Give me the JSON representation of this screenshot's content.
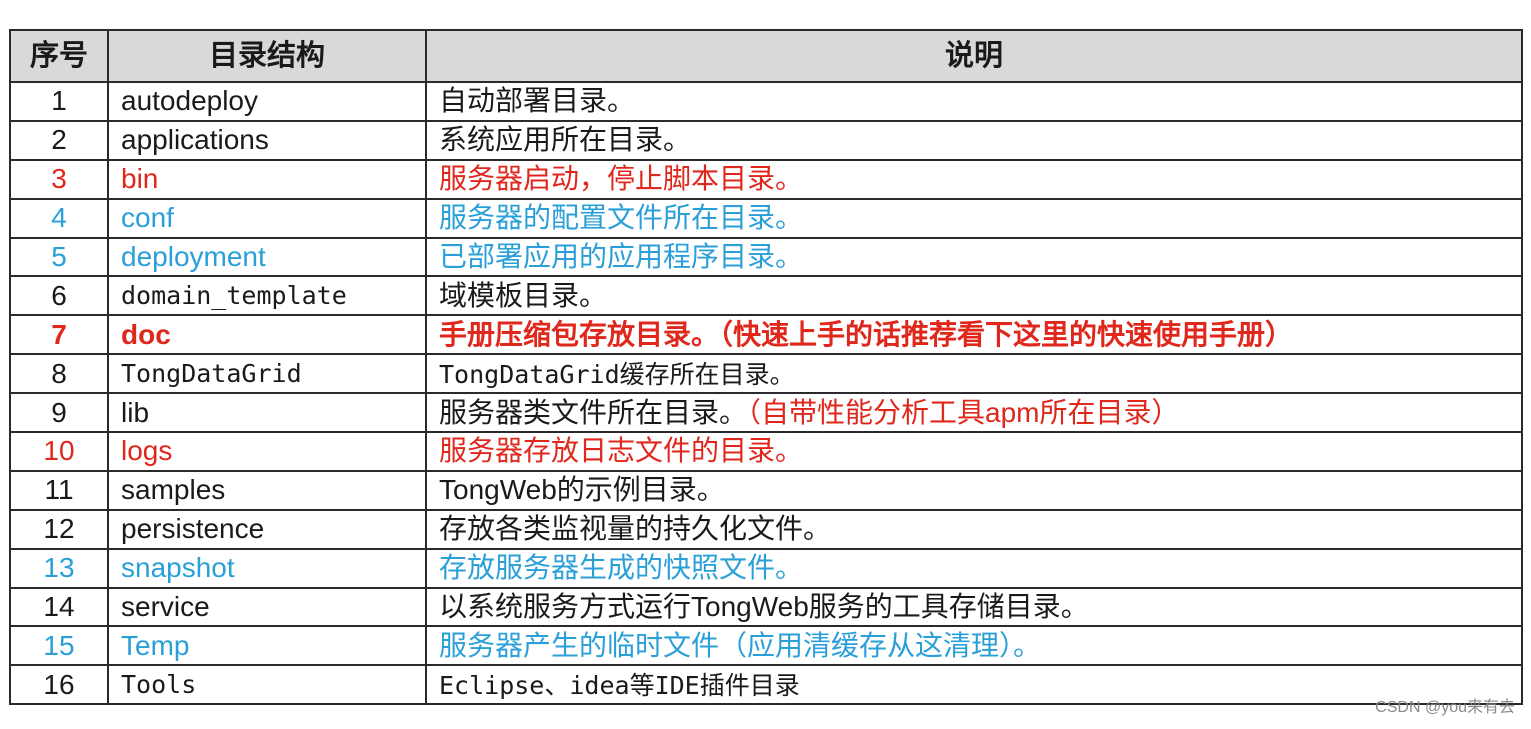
{
  "table": {
    "headers": [
      "序号",
      "目录结构",
      "说明"
    ],
    "rows": [
      {
        "no": "1",
        "name": "autodeploy",
        "desc": "自动部署目录。",
        "desc_extra": "",
        "style": "normal",
        "name_mono": false
      },
      {
        "no": "2",
        "name": "applications",
        "desc": "系统应用所在目录。",
        "desc_extra": "",
        "style": "normal",
        "name_mono": false
      },
      {
        "no": "3",
        "name": "bin",
        "desc": "服务器启动，停止脚本目录。",
        "desc_extra": "",
        "style": "red",
        "name_mono": false
      },
      {
        "no": "4",
        "name": "conf",
        "desc": "服务器的配置文件所在目录。",
        "desc_extra": "",
        "style": "blue",
        "name_mono": false
      },
      {
        "no": "5",
        "name": "deployment",
        "desc": "已部署应用的应用程序目录。",
        "desc_extra": "",
        "style": "blue",
        "name_mono": false
      },
      {
        "no": "6",
        "name": "domain_template",
        "desc": "域模板目录。",
        "desc_extra": "",
        "style": "normal",
        "name_mono": true
      },
      {
        "no": "7",
        "name": "doc",
        "desc": "手册压缩包存放目录。（快速上手的话推荐看下这里的快速使用手册）",
        "desc_extra": "",
        "style": "red-bold",
        "name_mono": false
      },
      {
        "no": "8",
        "name": "TongDataGrid",
        "desc": "TongDataGrid缓存所在目录。",
        "desc_extra": "",
        "style": "normal",
        "name_mono": true
      },
      {
        "no": "9",
        "name": "lib",
        "desc": "服务器类文件所在目录。",
        "desc_extra": "（自带性能分析工具apm所在目录）",
        "style": "normal",
        "name_mono": false
      },
      {
        "no": "10",
        "name": "logs",
        "desc": "服务器存放日志文件的目录。",
        "desc_extra": "",
        "style": "red",
        "name_mono": false
      },
      {
        "no": "11",
        "name": "samples",
        "desc": "TongWeb的示例目录。",
        "desc_extra": "",
        "style": "normal",
        "name_mono": false
      },
      {
        "no": "12",
        "name": "persistence",
        "desc": "存放各类监视量的持久化文件。",
        "desc_extra": "",
        "style": "normal",
        "name_mono": false
      },
      {
        "no": "13",
        "name": "snapshot",
        "desc": "存放服务器生成的快照文件。",
        "desc_extra": "",
        "style": "blue",
        "name_mono": false
      },
      {
        "no": "14",
        "name": "service",
        "desc": "以系统服务方式运行TongWeb服务的工具存储目录。",
        "desc_extra": "",
        "style": "normal",
        "name_mono": false
      },
      {
        "no": "15",
        "name": "Temp",
        "desc": "服务器产生的临时文件（应用清缓存从这清理）。",
        "desc_extra": "",
        "style": "blue",
        "name_mono": false
      },
      {
        "no": "16",
        "name": "Tools",
        "desc": "Eclipse、idea等IDE插件目录",
        "desc_extra": "",
        "style": "normal",
        "name_mono": true
      }
    ]
  },
  "colors": {
    "red": "#e0271c",
    "blue": "#2a9fd8",
    "header_bg": "#d9d9d9",
    "text": "#1a1a1a"
  },
  "watermark": "CSDN @you来有去"
}
